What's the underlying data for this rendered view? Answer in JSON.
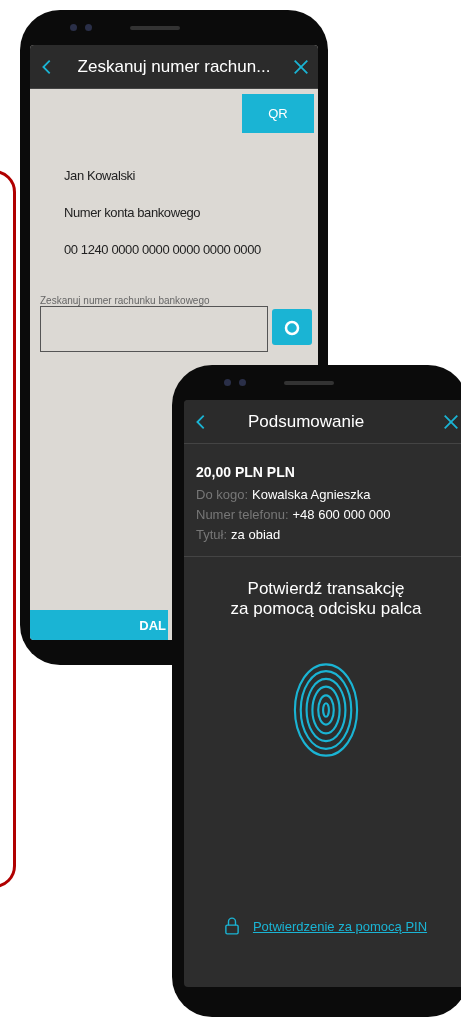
{
  "scan_screen": {
    "header": {
      "title": "Zeskanuj numer rachun..."
    },
    "qr_button": "QR",
    "document_lines": [
      "Jan Kowalski",
      "Numer konta bankowego",
      "00 1240 0000 0000 0000 0000 0000"
    ],
    "scan_field": {
      "label": "Zeskanuj numer rachunku bankowego"
    },
    "bottom_button": "DAL"
  },
  "summary_screen": {
    "header": {
      "title": "Podsumowanie"
    },
    "amount": "20,00 PLN PLN",
    "details": [
      {
        "label": "Do kogo:",
        "value": "Kowalska Agnieszka"
      },
      {
        "label": "Numer telefonu:",
        "value": "+48 600 000 000"
      },
      {
        "label": "Tytuł:",
        "value": "za obiad"
      }
    ],
    "prompt": "Potwierdź transakcję\nza pomocą odcisku palca",
    "pin_link": "Potwierdzenie za pomocą PIN"
  }
}
